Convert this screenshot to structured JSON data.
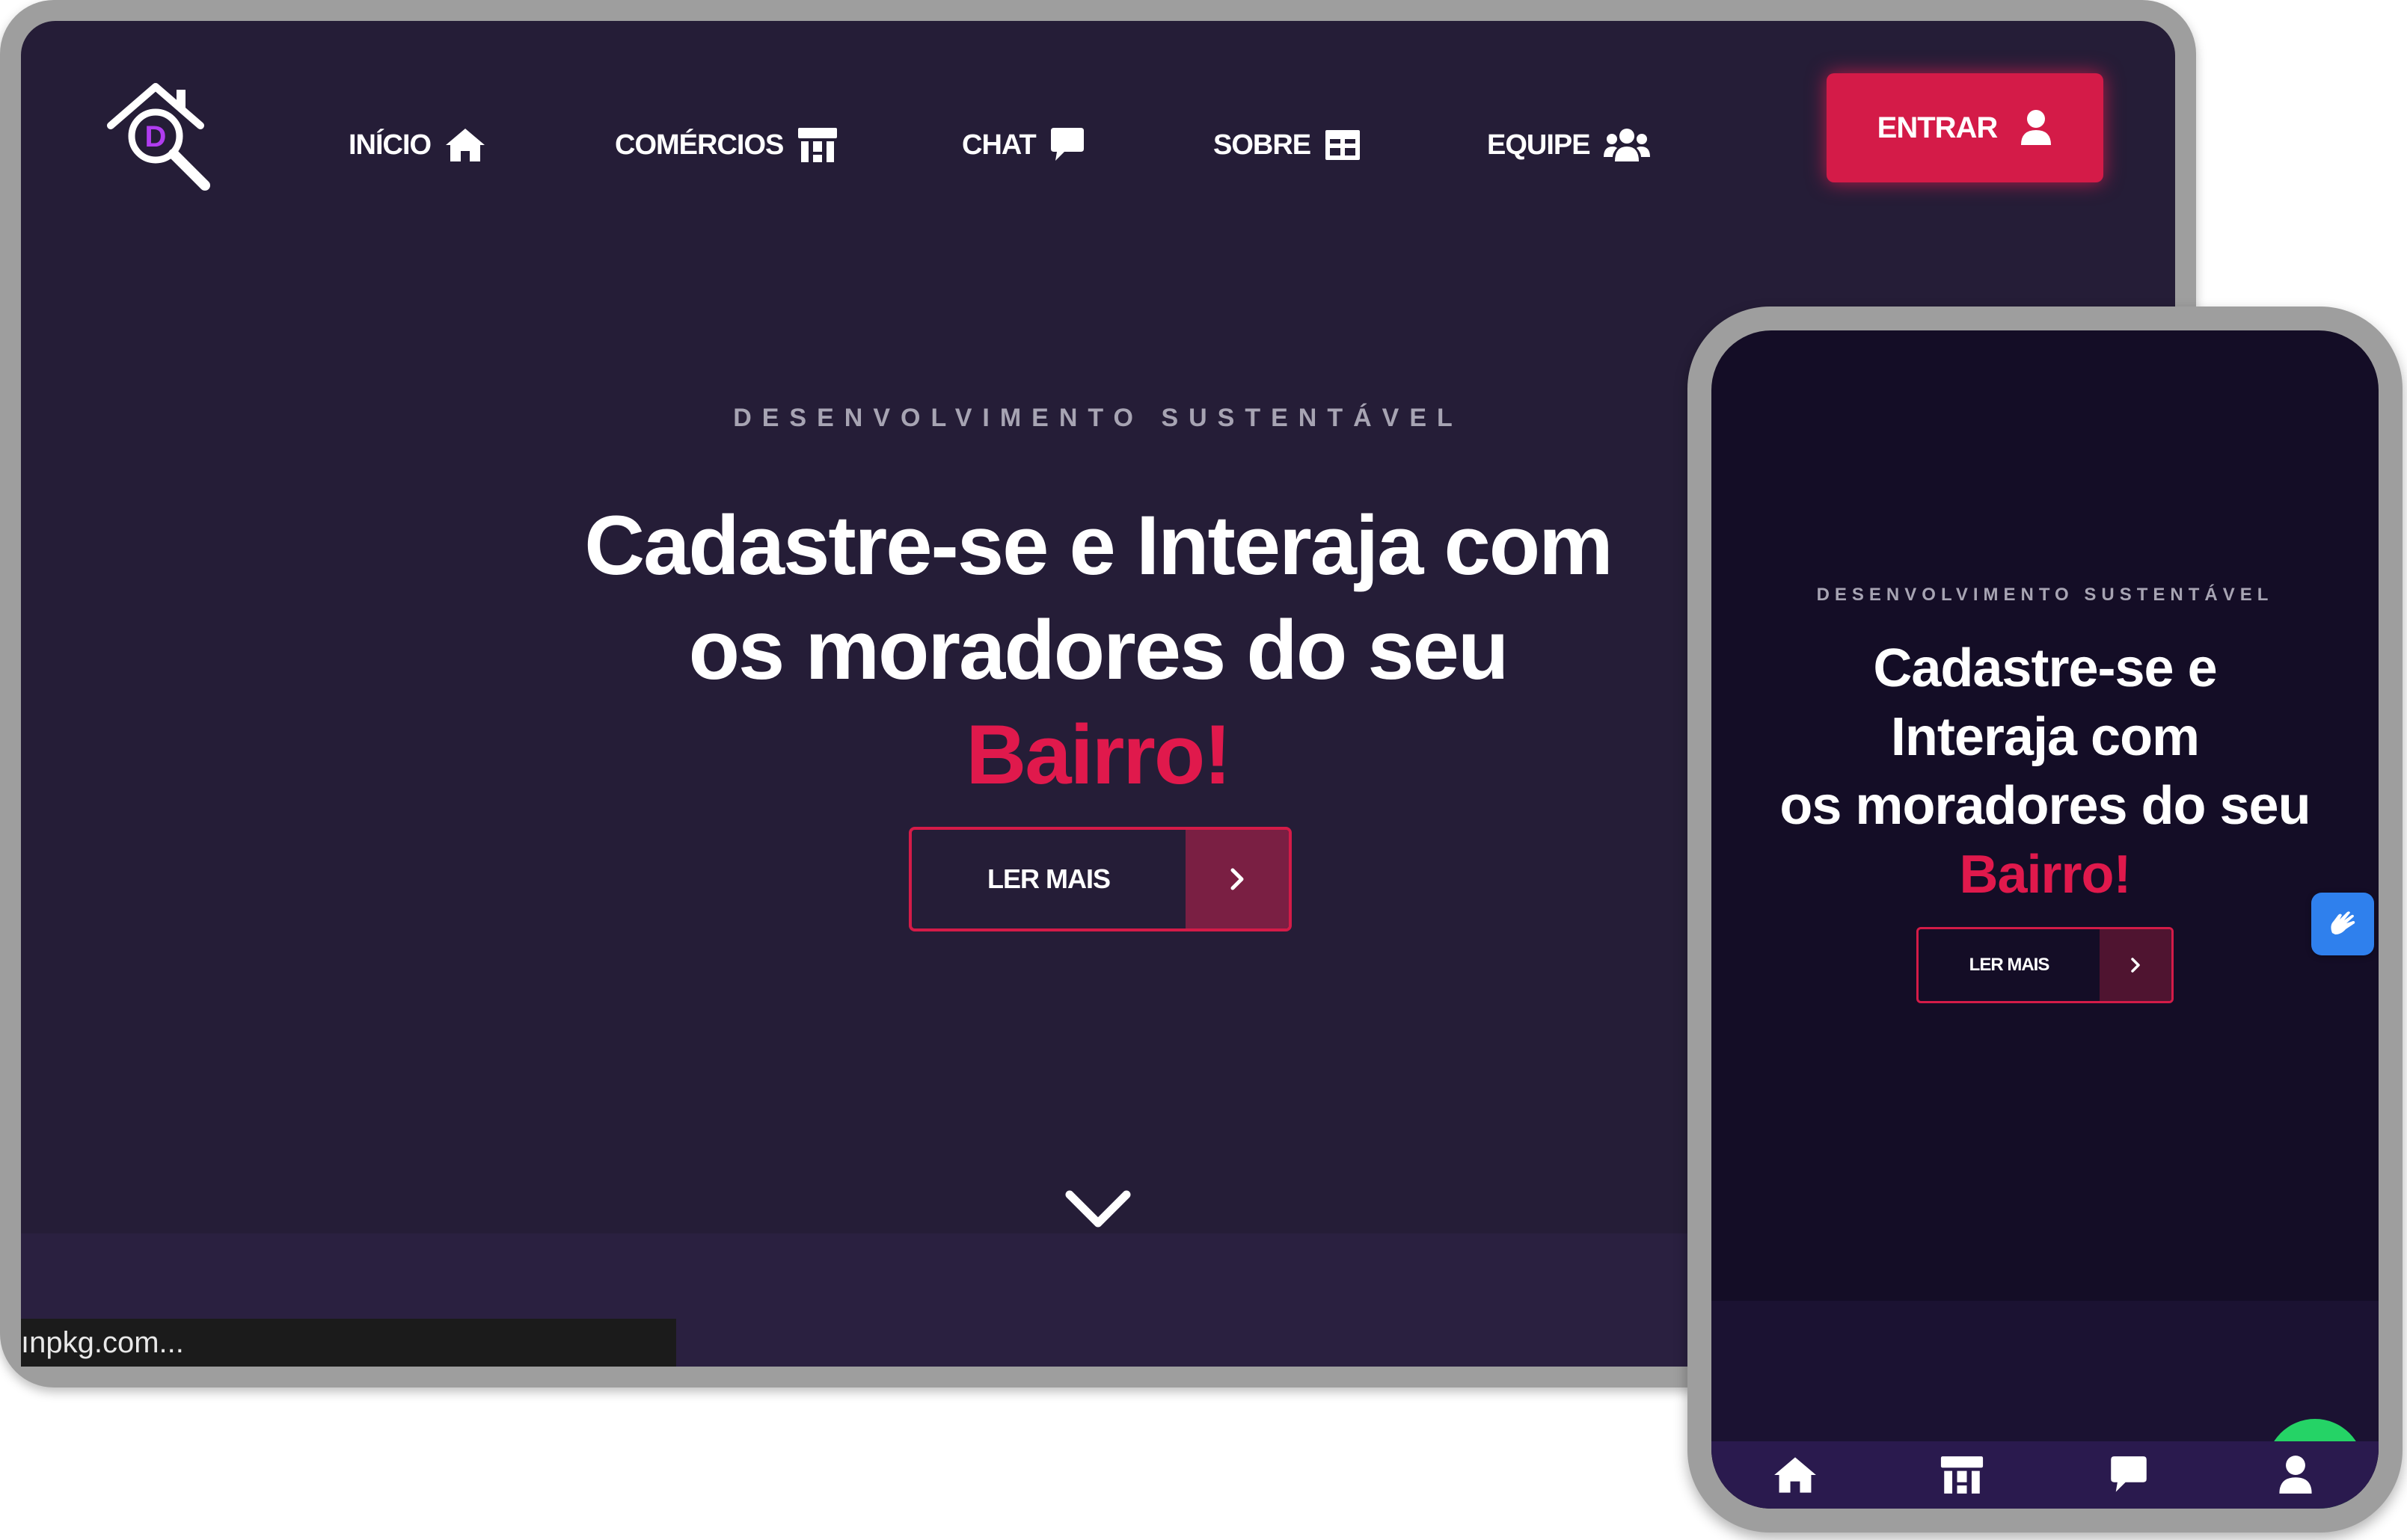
{
  "desktop": {
    "nav": {
      "items": [
        {
          "label": "INÍCIO",
          "icon": "home-icon"
        },
        {
          "label": "COMÉRCIOS",
          "icon": "store-icon"
        },
        {
          "label": "CHAT",
          "icon": "chat-bubble-icon"
        },
        {
          "label": "SOBRE",
          "icon": "table-icon"
        },
        {
          "label": "EQUIPE",
          "icon": "users-icon"
        }
      ],
      "login_label": "ENTRAR",
      "login_icon": "user-icon"
    },
    "hero": {
      "kicker": "DESENVOLVIMENTO SUSTENTÁVEL",
      "title_line1": "Cadastre-se e Interaja com",
      "title_line2": "os moradores do seu",
      "title_accent": "Bairro!",
      "cta_label": "LER MAIS"
    },
    "status_url": "ınpkg.com..."
  },
  "mobile": {
    "hero": {
      "kicker": "DESENVOLVIMENTO SUSTENTÁVEL",
      "title_line1": "Cadastre-se e",
      "title_line2": "Interaja com",
      "title_line3": "os moradores do seu",
      "title_accent": "Bairro!",
      "cta_label": "LER MAIS"
    },
    "tabbar": [
      "home-icon",
      "store-icon",
      "chat-bubble-icon",
      "user-icon"
    ]
  },
  "colors": {
    "background": "#251d37",
    "mobile_background": "#140d26",
    "accent": "#d41b48",
    "frame": "#9e9e9e",
    "accessibility": "#2f80ed",
    "whatsapp": "#25d366"
  }
}
